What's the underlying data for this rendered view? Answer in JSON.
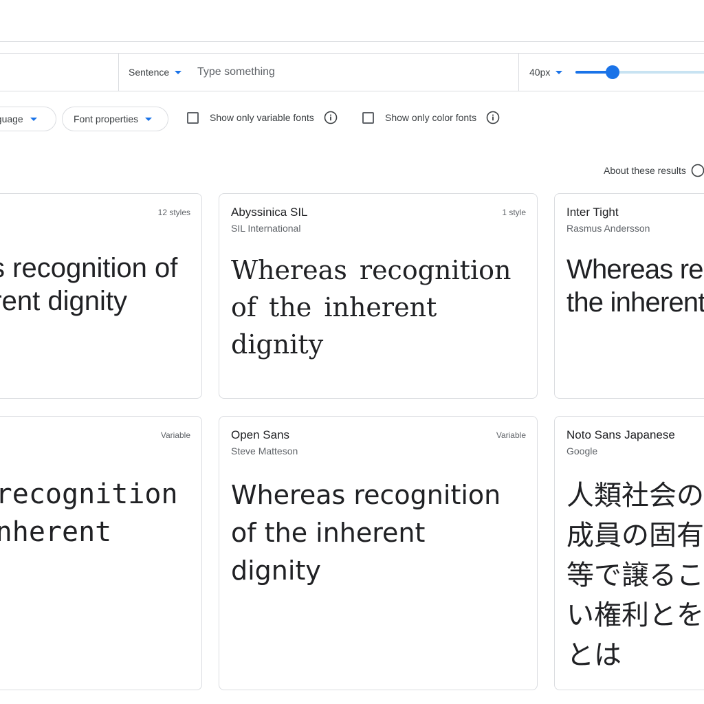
{
  "toolbar": {
    "preview_mode": "Sentence",
    "preview_placeholder": "Type something",
    "preview_value": "",
    "font_size": "40px",
    "font_size_value": 40,
    "font_size_min": 8,
    "font_size_max": 300
  },
  "filters": {
    "language_label": "nguage",
    "font_properties_label": "Font properties",
    "variable_only_label": "Show only variable fonts",
    "variable_only_checked": false,
    "color_only_label": "Show only color fonts",
    "color_only_checked": false
  },
  "results": {
    "about_label": "About these results"
  },
  "cards": [
    {
      "name": "",
      "designer": "",
      "meta": "12 styles",
      "sample": "Whereas recognition of the inherent dignity"
    },
    {
      "name": "Abyssinica SIL",
      "designer": "SIL International",
      "meta": "1 style",
      "sample": "Whereas recognition of the inherent dignity"
    },
    {
      "name": "Inter Tight",
      "designer": "Rasmus Andersson",
      "meta": "",
      "sample": "Whereas recognition of the inherent dignity"
    },
    {
      "name": "",
      "designer": "",
      "meta": "Variable",
      "sample": "Whereas recognition of the inherent dignity"
    },
    {
      "name": "Open Sans",
      "designer": "Steve Matteson",
      "meta": "Variable",
      "sample": "Whereas recognition of the inherent dignity"
    },
    {
      "name": "Noto Sans Japanese",
      "designer": "Google",
      "meta": "",
      "sample": "人類社会のすべての構成員の固有の尊厳と平等で譲ることのできない権利とを承認することは"
    }
  ],
  "colors": {
    "accent": "#1a73e8",
    "border": "#dadce0",
    "text": "#202124",
    "secondary_text": "#5f6368"
  }
}
